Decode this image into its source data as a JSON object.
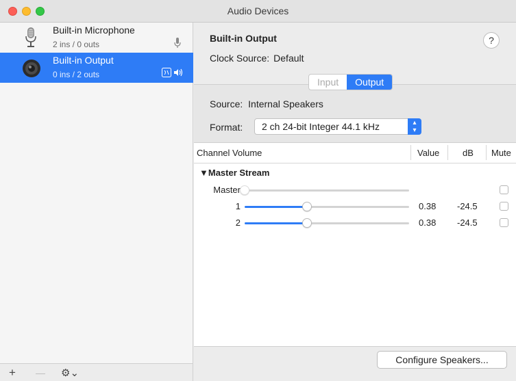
{
  "window": {
    "title": "Audio Devices"
  },
  "sidebar": {
    "devices": [
      {
        "name": "Built-in Microphone",
        "io": "2 ins / 0 outs",
        "icon": "microphone-icon",
        "badge": "mic-icon",
        "selected": false
      },
      {
        "name": "Built-in Output",
        "io": "0 ins / 2 outs",
        "icon": "speaker-icon",
        "badge": "finder-speaker-icon",
        "selected": true
      }
    ],
    "footer": {
      "add": "+",
      "remove": "—",
      "gear": "⚙⌄"
    }
  },
  "detail": {
    "device_title": "Built-in Output",
    "help": "?",
    "clock_label": "Clock Source:",
    "clock_value": "Default",
    "tabs": [
      {
        "label": "Input",
        "active": false
      },
      {
        "label": "Output",
        "active": true
      }
    ],
    "source_label": "Source:",
    "source_value": "Internal Speakers",
    "format_label": "Format:",
    "format_value": "2 ch 24-bit Integer 44.1 kHz"
  },
  "table": {
    "headers": {
      "channel": "Channel Volume",
      "value": "Value",
      "db": "dB",
      "mute": "Mute"
    },
    "group": "▼Master Stream",
    "rows": [
      {
        "label": "Master",
        "level": 0,
        "value": "",
        "db": "",
        "enabled": false,
        "muted": false
      },
      {
        "label": "1",
        "level": 0.38,
        "value": "0.38",
        "db": "-24.5",
        "enabled": true,
        "muted": false
      },
      {
        "label": "2",
        "level": 0.38,
        "value": "0.38",
        "db": "-24.5",
        "enabled": true,
        "muted": false
      }
    ]
  },
  "footer_button": "Configure Speakers...",
  "colors": {
    "accent": "#2e7cf6",
    "close": "#fc5f57",
    "minimize": "#fdbc2e",
    "maximize": "#33c748"
  }
}
